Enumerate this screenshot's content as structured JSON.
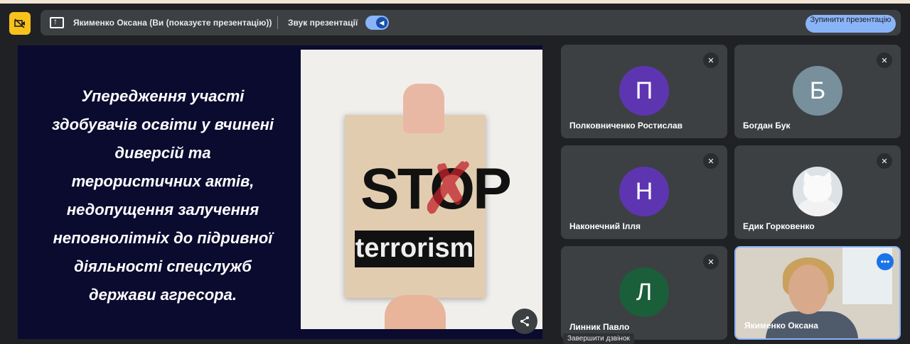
{
  "toolbar": {
    "presenter_text": "Якименко Оксана (Ви (показуєте презентацію))",
    "sound_label": "Звук презентації",
    "stop_button": "Зупинити презентацію"
  },
  "slide": {
    "text_lines": [
      "Упередження участі",
      "здобувачів освіти у вчинені",
      "диверсій та",
      "терористичних актів,",
      "недопущення залучення",
      "неповнолітніх до підривної",
      "діяльності спецслужб",
      "держави агресора."
    ],
    "image_stop": "STOP",
    "image_terrorism": "terrorism"
  },
  "participants": [
    {
      "name": "Полковниченко Ростислав",
      "initial": "П",
      "color": "#5e35b1",
      "muted": true
    },
    {
      "name": "Богдан Бук",
      "initial": "Б",
      "color": "#78909c",
      "muted": true
    },
    {
      "name": "Наконечний Ілля",
      "initial": "Н",
      "color": "#5e35b1",
      "muted": true
    },
    {
      "name": "Едик Горковенко",
      "initial": "",
      "avatar": "photo",
      "muted": true
    },
    {
      "name": "Линник Павло",
      "initial": "Л",
      "color": "#1b5e3a",
      "muted": true
    },
    {
      "name": "Якименко Оксана",
      "video": true
    }
  ],
  "tooltip": "Завершити дзвінок",
  "icons": {
    "camera_off": "camera-off-icon",
    "present": "present-icon",
    "mic_off": "mic-off-icon",
    "share": "share-icon",
    "more": "more-options-icon"
  }
}
